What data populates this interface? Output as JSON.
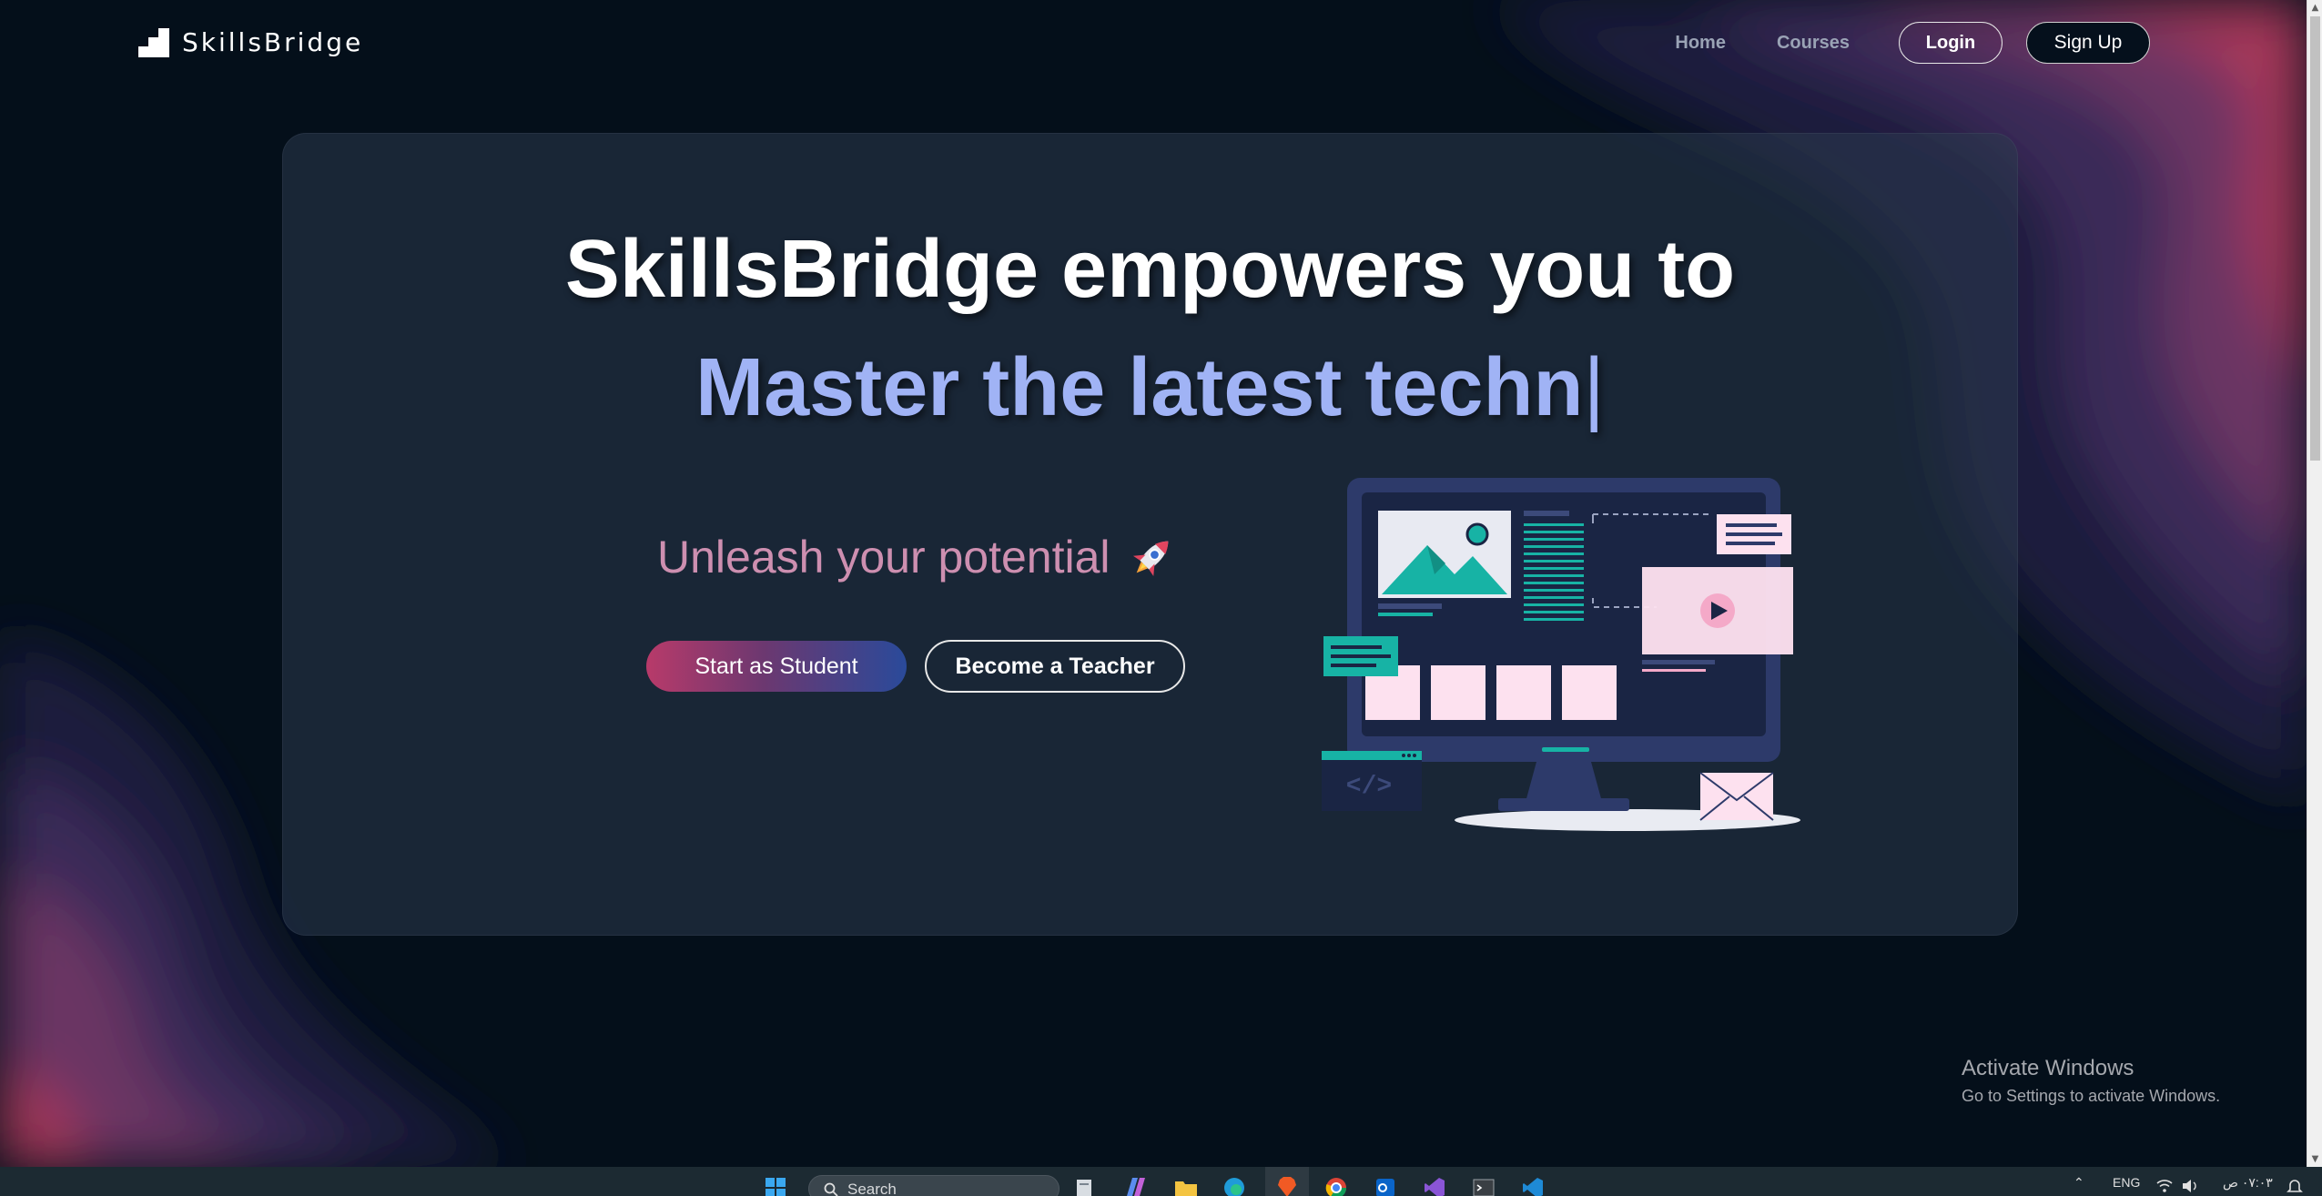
{
  "brand": {
    "name": "SkillsBridge"
  },
  "nav": {
    "home": "Home",
    "courses": "Courses",
    "login": "Login",
    "signup": "Sign Up"
  },
  "hero": {
    "title": "SkillsBridge empowers you to",
    "typing_text": "Master the latest techn",
    "typing_cursor": "|",
    "tagline": "Unleash your potential",
    "student_button": "Start as Student",
    "teacher_button": "Become a Teacher"
  },
  "illustration": {
    "code_glyph": "</>"
  },
  "watermark": {
    "title": "Activate Windows",
    "subtitle": "Go to Settings to activate Windows."
  },
  "taskbar": {
    "search_placeholder": "Search",
    "apps": [
      "start-icon",
      "file-icon",
      "copilot-icon",
      "folder-icon",
      "edge-icon",
      "brave-icon",
      "chrome-icon",
      "outlook-icon",
      "visual-studio-icon",
      "terminal-icon",
      "vscode-icon"
    ],
    "tray": {
      "language": "ENG",
      "time": "٠٧:٠٣ ص"
    }
  },
  "colors": {
    "background": "#040f1a",
    "accent_typing": "#a0b3f5",
    "tagline": "#cd8fb0",
    "teal": "#17b3a5",
    "pink_card": "#fde1ef",
    "monitor": "#2d3a6a"
  }
}
